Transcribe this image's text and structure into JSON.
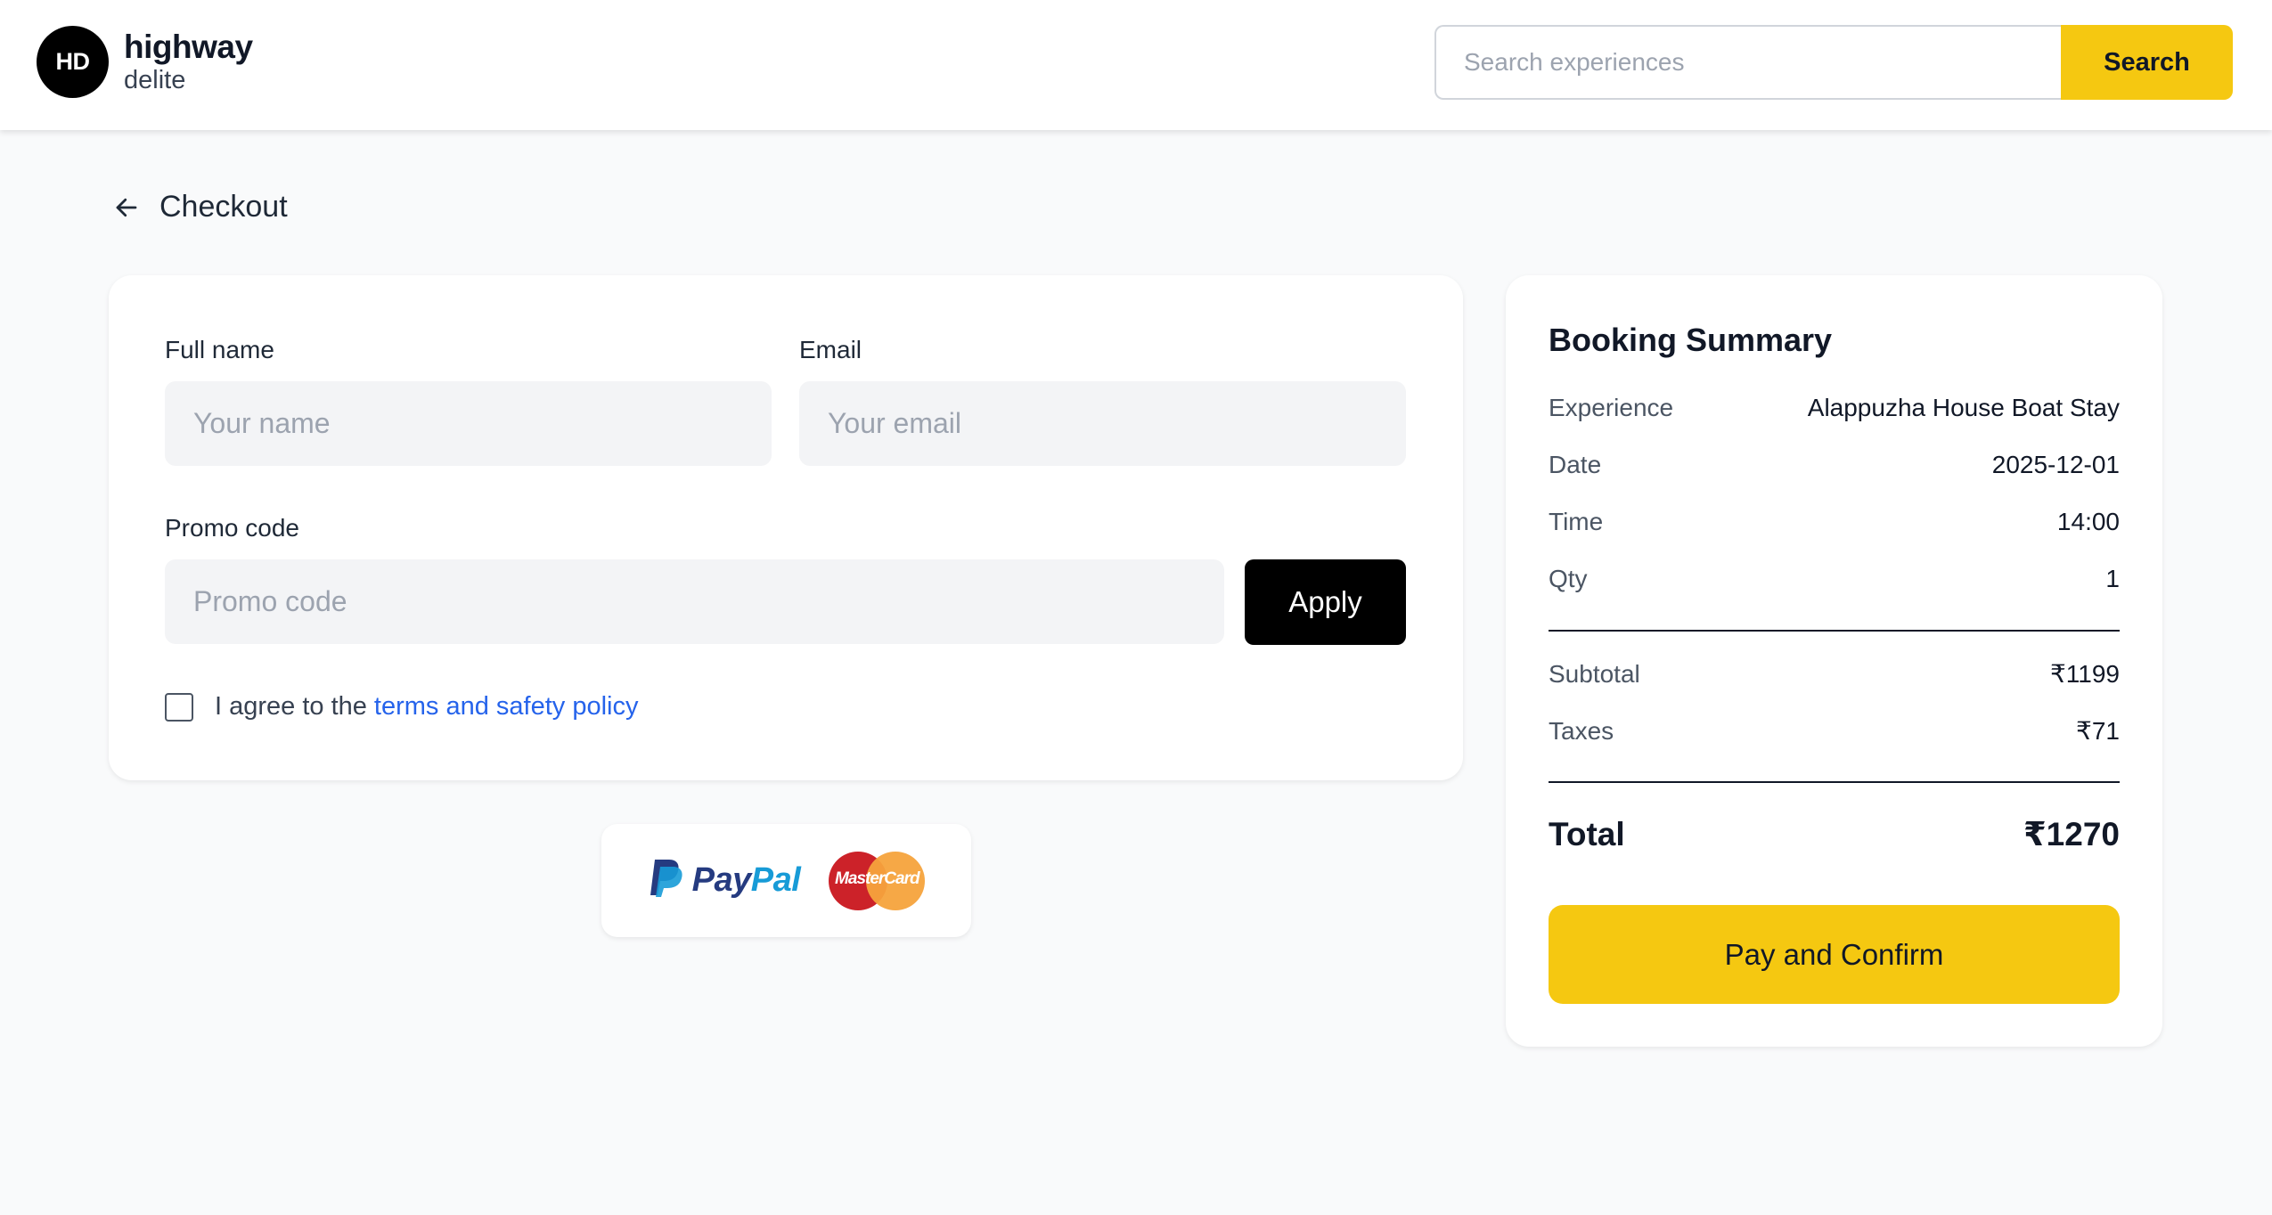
{
  "brand": {
    "badge": "HD",
    "title": "highway",
    "subtitle": "delite"
  },
  "search": {
    "placeholder": "Search experiences",
    "value": "",
    "button_label": "Search"
  },
  "page": {
    "back_icon": "arrow-left-icon",
    "title": "Checkout"
  },
  "form": {
    "full_name_label": "Full name",
    "full_name_placeholder": "Your name",
    "email_label": "Email",
    "email_placeholder": "Your email",
    "promo_label": "Promo code",
    "promo_placeholder": "Promo code",
    "apply_label": "Apply",
    "agree_text": "I agree to the",
    "agree_link": "terms and safety policy",
    "agree_checked": false
  },
  "payment": {
    "paypal_pay": "Pay",
    "paypal_pal": "Pal",
    "mastercard": "MasterCard"
  },
  "summary": {
    "title": "Booking Summary",
    "rows": [
      {
        "label": "Experience",
        "value": "Alappuzha House Boat Stay"
      },
      {
        "label": "Date",
        "value": "2025-12-01"
      },
      {
        "label": "Time",
        "value": "14:00"
      },
      {
        "label": "Qty",
        "value": "1"
      }
    ],
    "subtotal_label": "Subtotal",
    "subtotal_value": "₹1199",
    "taxes_label": "Taxes",
    "taxes_value": "₹71",
    "total_label": "Total",
    "total_value": "₹1270",
    "confirm_label": "Pay and Confirm"
  },
  "colors": {
    "accent": "#f5c811",
    "link": "#2563eb",
    "background": "#f9fafb"
  }
}
